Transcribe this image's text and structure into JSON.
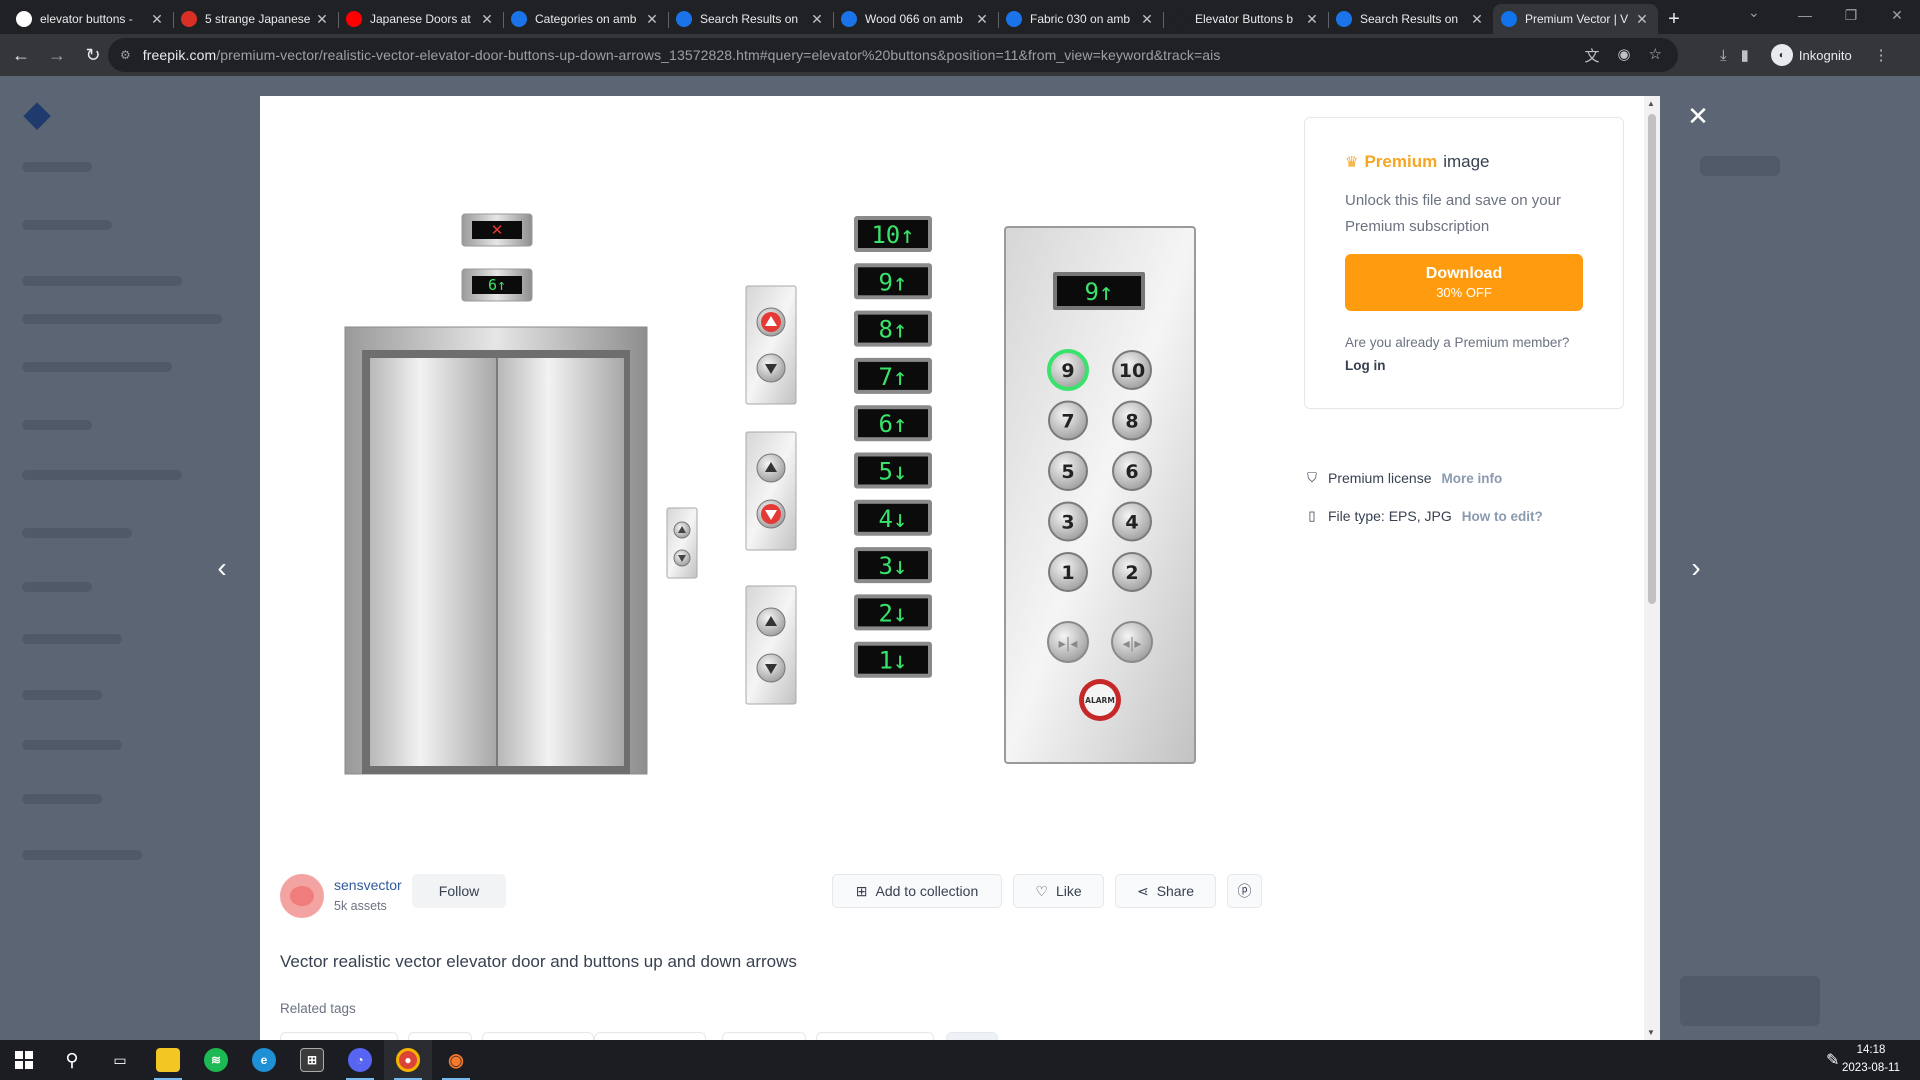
{
  "browser": {
    "tabs": [
      {
        "title": "elevator buttons - ",
        "favicon": "google-icon",
        "color": "#ffffff"
      },
      {
        "title": "5 strange Japanese",
        "favicon": "generic-icon",
        "color": "#d93025"
      },
      {
        "title": "Japanese Doors at",
        "favicon": "youtube-icon",
        "color": "#ff0000"
      },
      {
        "title": "Categories on amb",
        "favicon": "ambientcg-icon",
        "color": "#1a73e8"
      },
      {
        "title": "Search Results on",
        "favicon": "ambientcg-icon",
        "color": "#1a73e8"
      },
      {
        "title": "Wood 066 on amb",
        "favicon": "ambientcg-icon",
        "color": "#1a73e8"
      },
      {
        "title": "Fabric 030 on amb",
        "favicon": "ambientcg-icon",
        "color": "#1a73e8"
      },
      {
        "title": "Elevator Buttons b",
        "favicon": "shutterstock-icon",
        "color": "#202124"
      },
      {
        "title": "Search Results on",
        "favicon": "ambientcg-icon",
        "color": "#1a73e8"
      },
      {
        "title": "Premium Vector | V",
        "favicon": "freepik-icon",
        "color": "#1273eb"
      }
    ],
    "url_host": "freepik.com",
    "url_path": "/premium-vector/realistic-vector-elevator-door-buttons-up-down-arrows_13572828.htm#query=elevator%20buttons&position=11&from_view=keyword&track=ais",
    "profile_label": "Inkognito"
  },
  "modal": {
    "premium": {
      "title_accent": "Premium",
      "title_rest": "image",
      "description": "Unlock this file and save on your Premium subscription",
      "download_label": "Download",
      "download_sub": "30% OFF",
      "member_question": "Are you already a Premium member?",
      "login_label": "Log in"
    },
    "license": {
      "label": "Premium license",
      "link": "More info"
    },
    "filetype": {
      "label": "File type: EPS, JPG",
      "link": "How to edit?"
    },
    "author": {
      "name": "sensvector",
      "assets": "5k assets",
      "follow_label": "Follow"
    },
    "actions": {
      "collection_label": "Add to collection",
      "like_label": "Like",
      "share_label": "Share"
    },
    "asset_title": "Vector realistic vector elevator door and buttons up and down arrows",
    "related_label": "Related tags",
    "illustration": {
      "floor_displays": [
        "10↑",
        "9↑",
        "8↑",
        "7↑",
        "6↑",
        "5↓",
        "4↓",
        "3↓",
        "2↓",
        "1↓"
      ],
      "door_display_x": "✕",
      "door_display_floor": "6↑",
      "panel_display": "9↑",
      "panel_buttons": [
        "9",
        "10",
        "7",
        "8",
        "5",
        "6",
        "3",
        "4",
        "1",
        "2"
      ],
      "alarm_label": "ALARM",
      "display_color": "#39e36b"
    }
  },
  "taskbar": {
    "time": "14:18",
    "date": "2023-08-11"
  }
}
